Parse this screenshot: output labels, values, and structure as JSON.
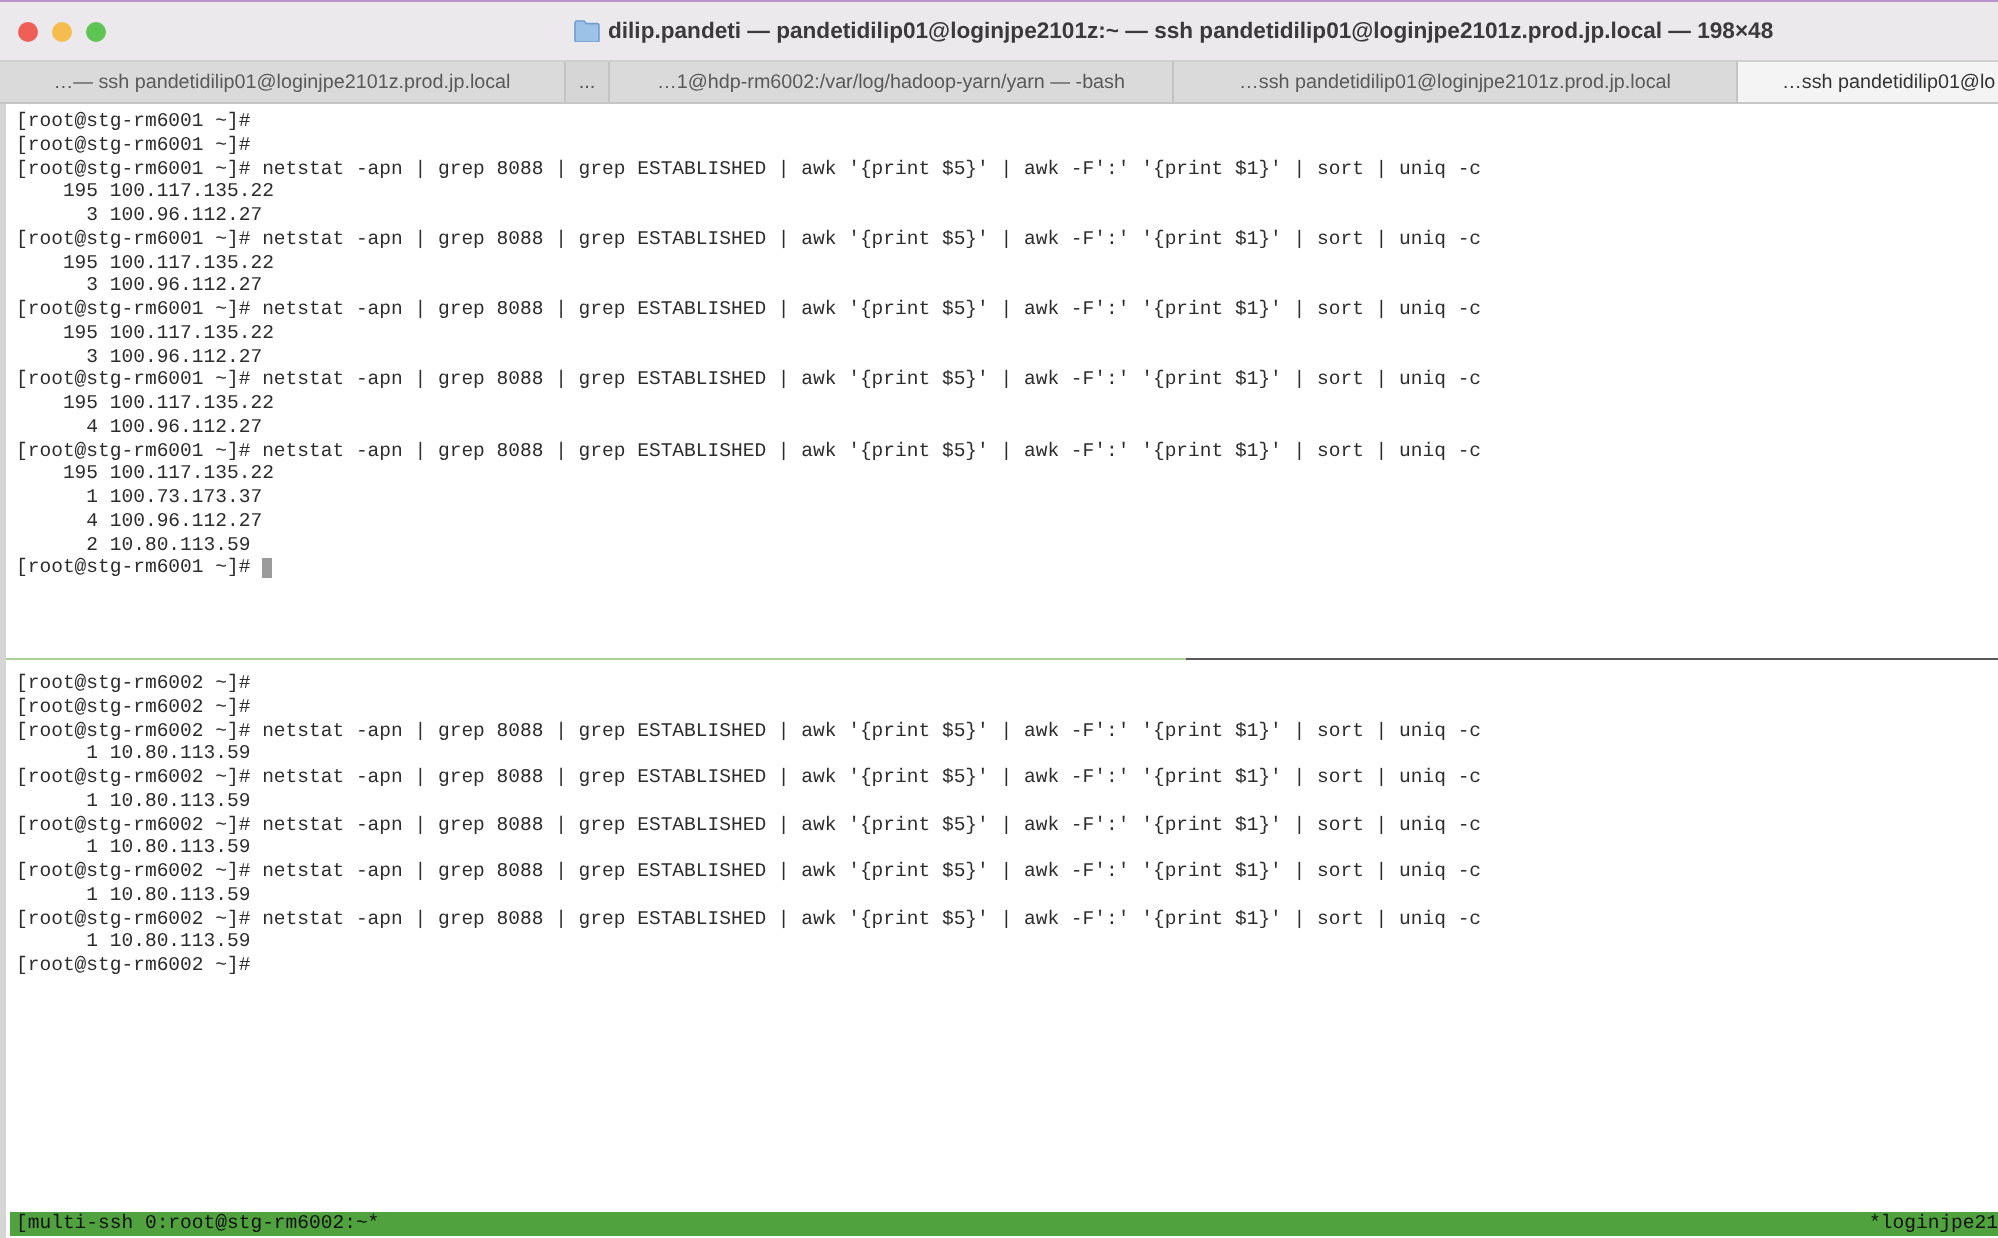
{
  "window": {
    "title": "dilip.pandeti — pandetidilip01@loginjpe2101z:~ — ssh pandetidilip01@loginjpe2101z.prod.jp.local — 198×48"
  },
  "tabs": [
    {
      "kind": "tab",
      "label": "…— ssh pandetidilip01@loginjpe2101z.prod.jp.local",
      "selected": false
    },
    {
      "kind": "overflow",
      "label": "..."
    },
    {
      "kind": "tab",
      "label": "…1@hdp-rm6002:/var/log/hadoop-yarn/yarn — -bash",
      "selected": false
    },
    {
      "kind": "tab",
      "label": "…ssh pandetidilip01@loginjpe2101z.prod.jp.local",
      "selected": false
    },
    {
      "kind": "tab",
      "label": "…ssh pandetidilip01@lo",
      "selected": true
    }
  ],
  "panes": [
    {
      "cursor": true,
      "lines": [
        {
          "kind": "prompt",
          "text": "[root@stg-rm6001 ~]#"
        },
        {
          "kind": "prompt",
          "text": "[root@stg-rm6001 ~]#"
        },
        {
          "kind": "prompt",
          "text": "[root@stg-rm6001 ~]# netstat -apn | grep 8088 | grep ESTABLISHED | awk '{print $5}' | awk -F':' '{print $1}' | sort | uniq -c"
        },
        {
          "kind": "output",
          "count": "195",
          "address": "100.117.135.22"
        },
        {
          "kind": "output",
          "count": "3",
          "address": "100.96.112.27"
        },
        {
          "kind": "prompt",
          "text": "[root@stg-rm6001 ~]# netstat -apn | grep 8088 | grep ESTABLISHED | awk '{print $5}' | awk -F':' '{print $1}' | sort | uniq -c"
        },
        {
          "kind": "output",
          "count": "195",
          "address": "100.117.135.22"
        },
        {
          "kind": "output",
          "count": "3",
          "address": "100.96.112.27"
        },
        {
          "kind": "prompt",
          "text": "[root@stg-rm6001 ~]# netstat -apn | grep 8088 | grep ESTABLISHED | awk '{print $5}' | awk -F':' '{print $1}' | sort | uniq -c"
        },
        {
          "kind": "output",
          "count": "195",
          "address": "100.117.135.22"
        },
        {
          "kind": "output",
          "count": "3",
          "address": "100.96.112.27"
        },
        {
          "kind": "prompt",
          "text": "[root@stg-rm6001 ~]# netstat -apn | grep 8088 | grep ESTABLISHED | awk '{print $5}' | awk -F':' '{print $1}' | sort | uniq -c"
        },
        {
          "kind": "output",
          "count": "195",
          "address": "100.117.135.22"
        },
        {
          "kind": "output",
          "count": "4",
          "address": "100.96.112.27"
        },
        {
          "kind": "prompt",
          "text": "[root@stg-rm6001 ~]# netstat -apn | grep 8088 | grep ESTABLISHED | awk '{print $5}' | awk -F':' '{print $1}' | sort | uniq -c"
        },
        {
          "kind": "output",
          "count": "195",
          "address": "100.117.135.22"
        },
        {
          "kind": "output",
          "count": "1",
          "address": "100.73.173.37"
        },
        {
          "kind": "output",
          "count": "4",
          "address": "100.96.112.27"
        },
        {
          "kind": "output",
          "count": "2",
          "address": "10.80.113.59"
        },
        {
          "kind": "prompt",
          "text": "[root@stg-rm6001 ~]#"
        }
      ]
    },
    {
      "cursor": false,
      "lines": [
        {
          "kind": "prompt",
          "text": "[root@stg-rm6002 ~]#"
        },
        {
          "kind": "prompt",
          "text": "[root@stg-rm6002 ~]#"
        },
        {
          "kind": "prompt",
          "text": "[root@stg-rm6002 ~]# netstat -apn | grep 8088 | grep ESTABLISHED | awk '{print $5}' | awk -F':' '{print $1}' | sort | uniq -c"
        },
        {
          "kind": "output",
          "count": "1",
          "address": "10.80.113.59"
        },
        {
          "kind": "prompt",
          "text": "[root@stg-rm6002 ~]# netstat -apn | grep 8088 | grep ESTABLISHED | awk '{print $5}' | awk -F':' '{print $1}' | sort | uniq -c"
        },
        {
          "kind": "output",
          "count": "1",
          "address": "10.80.113.59"
        },
        {
          "kind": "prompt",
          "text": "[root@stg-rm6002 ~]# netstat -apn | grep 8088 | grep ESTABLISHED | awk '{print $5}' | awk -F':' '{print $1}' | sort | uniq -c"
        },
        {
          "kind": "output",
          "count": "1",
          "address": "10.80.113.59"
        },
        {
          "kind": "prompt",
          "text": "[root@stg-rm6002 ~]# netstat -apn | grep 8088 | grep ESTABLISHED | awk '{print $5}' | awk -F':' '{print $1}' | sort | uniq -c"
        },
        {
          "kind": "output",
          "count": "1",
          "address": "10.80.113.59"
        },
        {
          "kind": "prompt",
          "text": "[root@stg-rm6002 ~]# netstat -apn | grep 8088 | grep ESTABLISHED | awk '{print $5}' | awk -F':' '{print $1}' | sort | uniq -c"
        },
        {
          "kind": "output",
          "count": "1",
          "address": "10.80.113.59"
        },
        {
          "kind": "prompt",
          "text": "[root@stg-rm6002 ~]#"
        }
      ]
    }
  ],
  "status_bar": {
    "left": "[multi-ssh 0:root@stg-rm6002:~*",
    "right": "*loginjpe21"
  }
}
